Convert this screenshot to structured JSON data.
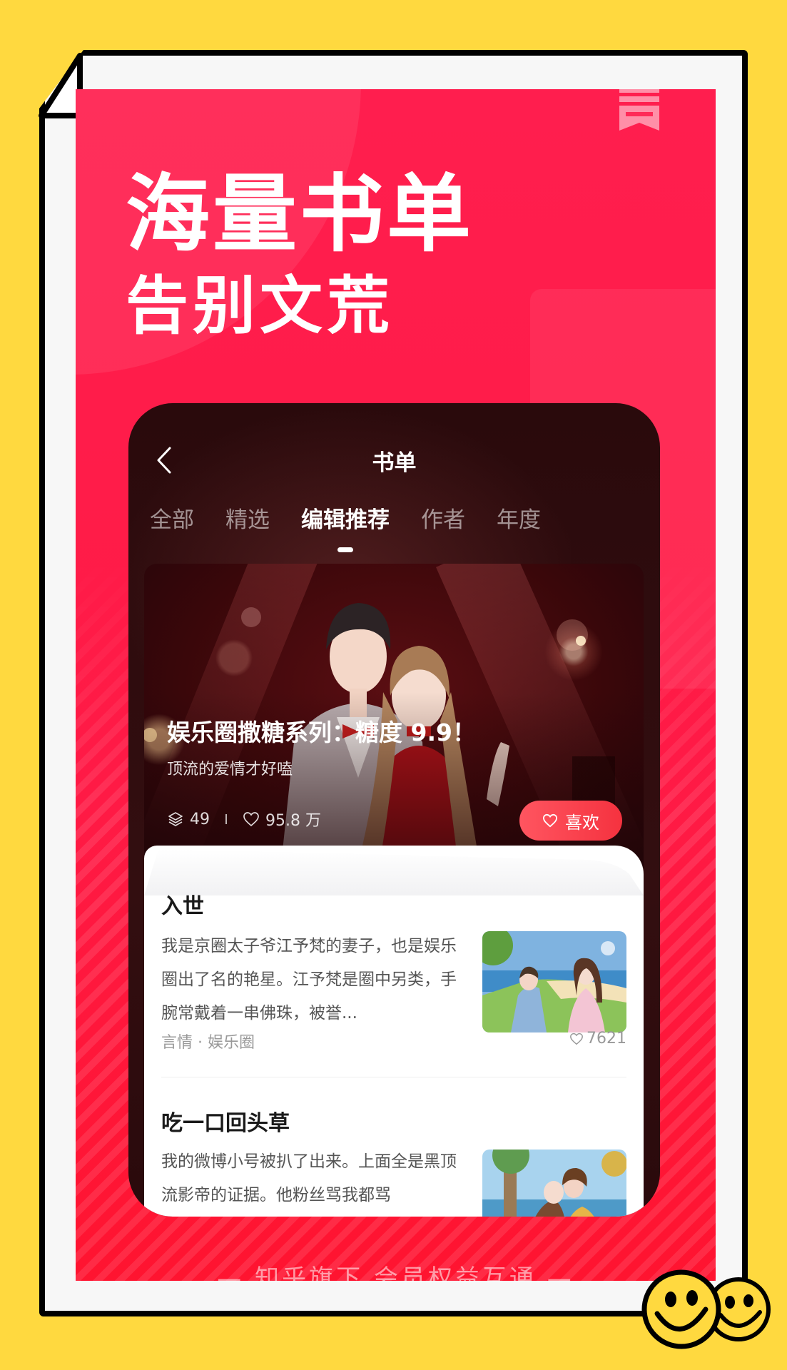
{
  "colors": {
    "background_yellow": "#FFD93F",
    "frame_black": "#000000",
    "frame_inner": "#F7F7F7",
    "brand_red": "#FF1E4E",
    "phone_dark": "#2A0A0C",
    "like_button": "#F5323F"
  },
  "headline": {
    "line1": "海量书单",
    "line2": "告别文荒"
  },
  "tagline": "— 知乎旗下 会员权益互通 —",
  "app": {
    "nav_title": "书单",
    "back_icon": "chevron-left-icon",
    "tabs": [
      {
        "label": "全部",
        "active": false
      },
      {
        "label": "精选",
        "active": false
      },
      {
        "label": "编辑推荐",
        "active": true
      },
      {
        "label": "作者",
        "active": false
      },
      {
        "label": "年度",
        "active": false
      }
    ],
    "featured": {
      "title": "娱乐圈撒糖系列：糖度 9.9！",
      "subtitle": "顶流的爱情才好嗑",
      "book_count_icon": "layers-icon",
      "book_count": "49",
      "likes_icon": "heart-outline-icon",
      "likes": "95.8 万",
      "like_button_label": "喜欢"
    },
    "books": [
      {
        "title": "入世",
        "description": "我是京圈太子爷江予梵的妻子，也是娱乐圈出了名的艳星。江予梵是圈中另类，手腕常戴着一串佛珠，被誉...",
        "tags": "言情 · 娱乐圈",
        "likes": "7621"
      },
      {
        "title": "吃一口回头草",
        "description": "我的微博小号被扒了出来。上面全是黑顶流影帝的证据。他粉丝骂我都骂"
      }
    ]
  }
}
